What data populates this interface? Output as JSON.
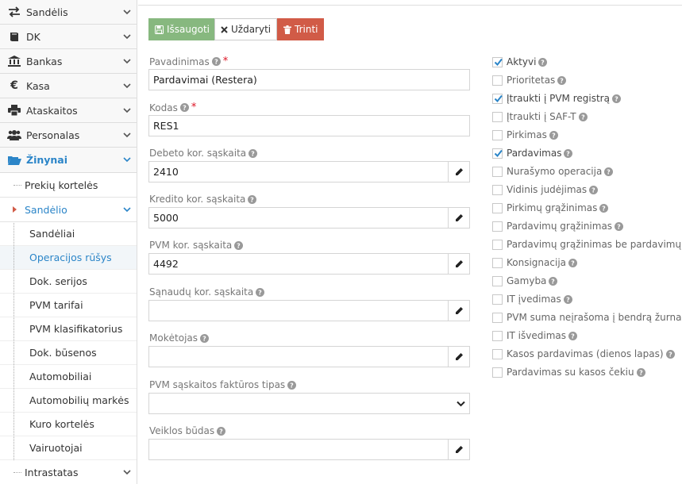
{
  "sidebar": {
    "top_items": [
      {
        "label": "Sandėlis",
        "icon": "exchange-icon"
      },
      {
        "label": "DK",
        "icon": "book-icon"
      },
      {
        "label": "Bankas",
        "icon": "bank-icon"
      },
      {
        "label": "Kasa",
        "icon": "euro-icon"
      },
      {
        "label": "Ataskaitos",
        "icon": "print-icon"
      },
      {
        "label": "Personalas",
        "icon": "users-icon"
      }
    ],
    "active_item": {
      "label": "Žinynai",
      "icon": "folder-open-icon"
    },
    "sub_items": [
      {
        "label": "Prekių kortelės"
      },
      {
        "label": "Sandėlio"
      }
    ],
    "subsub_items": [
      {
        "label": "Sandėliai"
      },
      {
        "label": "Operacijos rūšys"
      },
      {
        "label": "Dok. serijos"
      },
      {
        "label": "PVM tarifai"
      },
      {
        "label": "PVM klasifikatorius"
      },
      {
        "label": "Dok. būsenos"
      },
      {
        "label": "Automobiliai"
      },
      {
        "label": "Automobilių markės"
      },
      {
        "label": "Kuro kortelės"
      },
      {
        "label": "Vairuotojai"
      }
    ],
    "last_item": {
      "label": "Intrastatas"
    }
  },
  "toolbar": {
    "save_label": "Išsaugoti",
    "close_label": "Uždaryti",
    "delete_label": "Trinti"
  },
  "form": {
    "name": {
      "label": "Pavadinimas",
      "value": "Pardavimai (Restera)",
      "required": "*"
    },
    "code": {
      "label": "Kodas",
      "value": "RES1",
      "required": "*"
    },
    "debit": {
      "label": "Debeto kor. sąskaita",
      "value": "2410"
    },
    "credit": {
      "label": "Kredito kor. sąskaita",
      "value": "5000"
    },
    "vat": {
      "label": "PVM kor. sąskaita",
      "value": "4492"
    },
    "expense": {
      "label": "Sąnaudų kor. sąskaita",
      "value": ""
    },
    "payer": {
      "label": "Mokėtojas",
      "value": ""
    },
    "invoice_type": {
      "label": "PVM sąskaitos faktūros tipas",
      "value": ""
    },
    "activity": {
      "label": "Veiklos būdas",
      "value": ""
    }
  },
  "checkboxes": [
    {
      "label": "Aktyvi",
      "checked": true
    },
    {
      "label": "Prioritetas",
      "checked": false
    },
    {
      "label": "Įtraukti į PVM registrą",
      "checked": true
    },
    {
      "label": "Įtraukti į SAF-T",
      "checked": false
    },
    {
      "label": "Pirkimas",
      "checked": false
    },
    {
      "label": "Pardavimas",
      "checked": true
    },
    {
      "label": "Nurašymo operacija",
      "checked": false
    },
    {
      "label": "Vidinis judėjimas",
      "checked": false
    },
    {
      "label": "Pirkimų grąžinimas",
      "checked": false
    },
    {
      "label": "Pardavimų grąžinimas",
      "checked": false
    },
    {
      "label": "Pardavimų grąžinimas be pardavimų",
      "checked": false
    },
    {
      "label": "Konsignacija",
      "checked": false
    },
    {
      "label": "Gamyba",
      "checked": false
    },
    {
      "label": "IT įvedimas",
      "checked": false
    },
    {
      "label": "PVM suma neįrašoma į bendrą žurnalą",
      "checked": false
    },
    {
      "label": "IT išvedimas",
      "checked": false
    },
    {
      "label": "Kasos pardavimas (dienos lapas)",
      "checked": false
    },
    {
      "label": "Pardavimas su kasos čekiu",
      "checked": false
    }
  ],
  "colors": {
    "accent": "#2b85c8",
    "save": "#87b87f",
    "delete": "#d15b47"
  }
}
